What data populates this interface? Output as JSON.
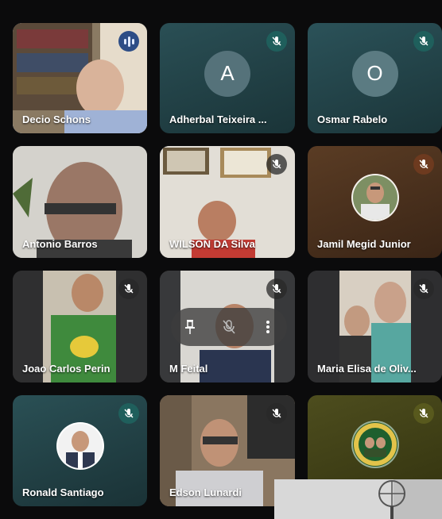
{
  "participants": [
    {
      "name": "Decio Schons",
      "state": "speaking"
    },
    {
      "name": "Adherbal Teixeira ...",
      "state": "muted",
      "avatar_letter": "A"
    },
    {
      "name": "Osmar Rabelo",
      "state": "muted",
      "avatar_letter": "O"
    },
    {
      "name": "Antonio Barros",
      "state": "unmuted"
    },
    {
      "name": "WILSON DA Silva",
      "state": "muted"
    },
    {
      "name": "Jamil Megid Junior",
      "state": "muted"
    },
    {
      "name": "Joao Carlos Perin",
      "state": "muted"
    },
    {
      "name": "M Feital",
      "state": "muted"
    },
    {
      "name": "Maria Elisa de Oliv...",
      "state": "muted"
    },
    {
      "name": "Ronald Santiago",
      "state": "muted"
    },
    {
      "name": "Edson Lunardi",
      "state": "muted"
    },
    {
      "name": "",
      "state": "muted"
    }
  ],
  "tile_overlay_controls": {
    "icons": [
      "pin-icon",
      "mute-icon",
      "more-options-icon"
    ]
  },
  "colors": {
    "background": "#0b0b0c",
    "speaking_outline": "#b7cdf5",
    "teal_tile": "#1f4f55",
    "brown_tile": "#4b3422",
    "olive_tile": "#4a4a1b"
  }
}
